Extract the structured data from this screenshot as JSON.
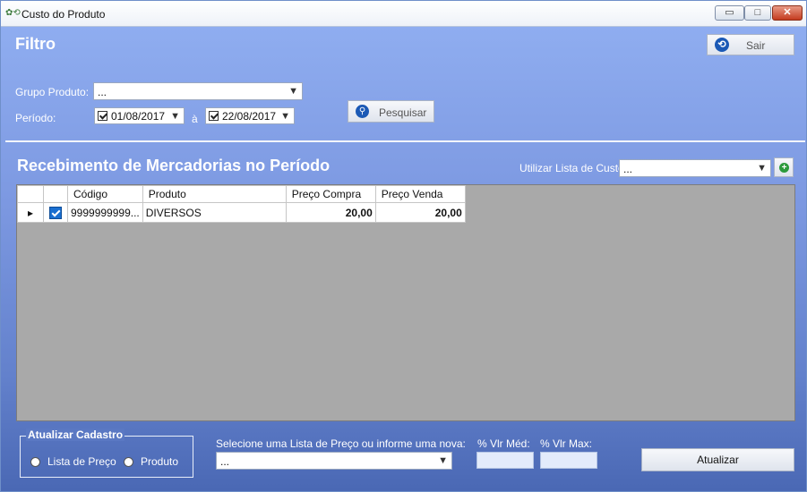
{
  "window": {
    "title": "Custo do Produto",
    "controls": {
      "minimize": "▭",
      "maximize": "□",
      "close": "✕"
    }
  },
  "filter": {
    "heading": "Filtro",
    "exit_label": "Sair",
    "group_label": "Grupo Produto:",
    "group_value": "...",
    "period_label": "Período:",
    "date_from": "01/08/2017",
    "date_sep": "à",
    "date_to": "22/08/2017",
    "search_label": "Pesquisar"
  },
  "receiving": {
    "heading": "Recebimento de Mercadorias no Período",
    "cost_list_label": "Utilizar Lista de Custo:",
    "cost_list_value": "...",
    "columns": [
      "Código",
      "Produto",
      "Preço Compra",
      "Preço Venda"
    ],
    "rows": [
      {
        "codigo": "9999999999...",
        "produto": "DIVERSOS",
        "preco_compra": "20,00",
        "preco_venda": "20,00"
      }
    ]
  },
  "update": {
    "group_title": "Atualizar Cadastro",
    "option_price_list": "Lista de Preço",
    "option_product": "Produto",
    "select_label": "Selecione uma Lista de Preço ou informe uma nova:",
    "select_value": "...",
    "vlr_med_label": "% Vlr Méd:",
    "vlr_max_label": "% Vlr Max:",
    "update_button": "Atualizar"
  },
  "colors": {
    "accent": "#7b97e0",
    "checkbox": "#1a6fd0"
  }
}
